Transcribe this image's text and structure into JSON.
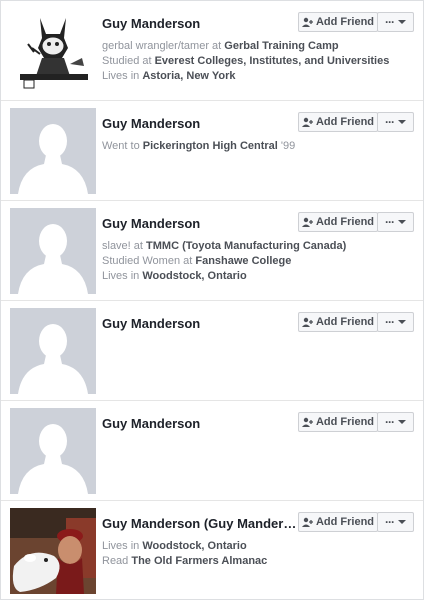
{
  "buttons": {
    "add_friend": "Add Friend",
    "more": "···"
  },
  "people": [
    {
      "name": "Guy Manderson",
      "photo": "cartoon-cat-at-desk",
      "lines": [
        {
          "prefix": "gerbal wrangler/tamer at ",
          "bold": "Gerbal Training Camp",
          "suffix": ""
        },
        {
          "prefix": "Studied at ",
          "bold": "Everest Colleges, Institutes, and Universities",
          "suffix": ""
        },
        {
          "prefix": "Lives in ",
          "bold": "Astoria, New York",
          "suffix": ""
        }
      ]
    },
    {
      "name": "Guy Manderson",
      "photo": "default-silhouette",
      "lines": [
        {
          "prefix": "Went to ",
          "bold": "Pickerington High Central",
          "suffix": " '99"
        }
      ]
    },
    {
      "name": "Guy Manderson",
      "photo": "default-silhouette",
      "lines": [
        {
          "prefix": "slave! at ",
          "bold": "TMMC (Toyota Manufacturing Canada)",
          "suffix": ""
        },
        {
          "prefix": "Studied Women at ",
          "bold": "Fanshawe College",
          "suffix": ""
        },
        {
          "prefix": "Lives in ",
          "bold": "Woodstock, Ontario",
          "suffix": ""
        }
      ]
    },
    {
      "name": "Guy Manderson",
      "photo": "default-silhouette",
      "lines": []
    },
    {
      "name": "Guy Manderson",
      "photo": "default-silhouette",
      "lines": []
    },
    {
      "name": "Guy Manderson (Guy Manderson)",
      "photo": "man-with-dog-photo",
      "lines": [
        {
          "prefix": "Lives in ",
          "bold": "Woodstock, Ontario",
          "suffix": ""
        },
        {
          "prefix": "Read ",
          "bold": "The Old Farmers Almanac",
          "suffix": ""
        }
      ]
    }
  ]
}
